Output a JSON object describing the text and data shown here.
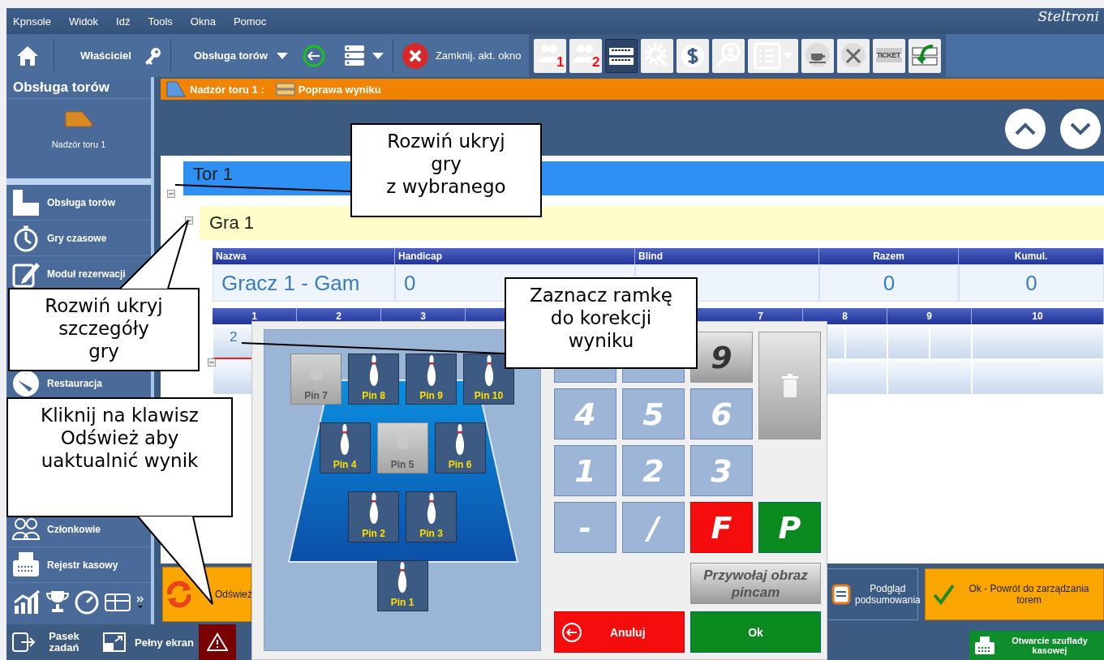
{
  "menu": {
    "items": [
      "Kpnsole",
      "Widok",
      "Idź",
      "Tools",
      "Okna",
      "Pomoc"
    ],
    "logo": "Steltroni"
  },
  "toolbar": {
    "user": "Właściciel",
    "module": "Obsługa torów",
    "close_label": "Zamknij. akt. okno",
    "icons": [
      {
        "badge": "1",
        "selected": false
      },
      {
        "badge": "2",
        "selected": false
      },
      {
        "selected": true
      },
      {
        "selected": false
      },
      {
        "selected": false
      },
      {
        "selected": false
      },
      {
        "selected": false
      },
      {
        "selected": false
      },
      {
        "selected": false
      },
      {
        "badge": "TICKET",
        "selected": false
      },
      {
        "selected": false
      }
    ]
  },
  "sidebar": {
    "title": "Obsługa torów",
    "lanes": [
      {
        "label": "Nadzór toru 1",
        "selected": false
      }
    ],
    "nav": [
      "Obsługa torów",
      "Gry czasowe",
      "Moduł rezerwacji",
      "Restauracja",
      "Członkowie",
      "Rejestr kasowy"
    ]
  },
  "breadcrumb": [
    "Nadzór toru 1 :",
    "Poprawa wyniku"
  ],
  "lane": {
    "title": "Tor 1",
    "expanded": true
  },
  "game": {
    "title": "Gra 1",
    "expanded": true
  },
  "players": {
    "columns": [
      "Nazwa",
      "Handicap",
      "Blind",
      "Razem",
      "Kumul."
    ],
    "rows": [
      {
        "name": "Gracz 1  - Gam",
        "handicap": "0",
        "total": "0",
        "cumulative": "0",
        "expanded": true
      }
    ]
  },
  "frames": {
    "headers": [
      "1",
      "2",
      "3",
      "7",
      "8",
      "9",
      "10"
    ],
    "scores": [
      {
        "value": "2",
        "selected": true
      }
    ]
  },
  "dialog": {
    "pin_rows": [
      [
        {
          "label": "Pin 7",
          "standing": false
        },
        {
          "label": "Pin 8",
          "standing": true
        },
        {
          "label": "Pin 9",
          "standing": true
        },
        {
          "label": "Pin 10",
          "standing": true
        }
      ],
      [
        {
          "label": "Pin 4",
          "standing": true
        },
        {
          "label": "Pin 5",
          "standing": false
        },
        {
          "label": "Pin 6",
          "standing": true
        }
      ],
      [
        {
          "label": "Pin 2",
          "standing": true
        },
        {
          "label": "Pin 3",
          "standing": true
        }
      ],
      [
        {
          "label": "Pin 1",
          "standing": true
        }
      ]
    ],
    "keys": [
      {
        "kind": "digit"
      },
      {
        "kind": "digit"
      },
      {
        "label": "9",
        "kind": "gray"
      },
      {
        "kind": "trash"
      },
      {
        "label": "4",
        "kind": "digit"
      },
      {
        "label": "5",
        "kind": "digit"
      },
      {
        "label": "6",
        "kind": "digit"
      },
      {
        "label": "1",
        "kind": "digit"
      },
      {
        "label": "2",
        "kind": "digit"
      },
      {
        "label": "3",
        "kind": "digit"
      },
      {
        "kind": "blank"
      },
      {
        "label": "-",
        "kind": "digit"
      },
      {
        "label": "/",
        "kind": "digit"
      },
      {
        "label": "F",
        "kind": "red"
      },
      {
        "label": "P",
        "kind": "green"
      }
    ],
    "pincam": "Przywołaj obraz pincam",
    "cancel": "Anuluj",
    "ok": "Ok"
  },
  "actions": {
    "refresh": "Odśwież",
    "summary": "Podgląd podsumowania",
    "back": "Ok -  Powrót do zarządzania torem"
  },
  "status_bar": {
    "taskbar": "Pasek zadań",
    "fullscreen": "Pełny ekran",
    "drawer": "Otwarcie szuflady kasowej"
  },
  "callouts": [
    {
      "text": "Rozwiń ukryj\ngry\nz wybranego"
    },
    {
      "text": "Rozwiń ukryj\nszczegóły\ngry"
    },
    {
      "text": "Zaznacz ramkę\ndo korekcji\nwyniku"
    },
    {
      "text": "Kliknij na klawisz\nOdśwież aby\nuaktualnić wynik"
    }
  ]
}
